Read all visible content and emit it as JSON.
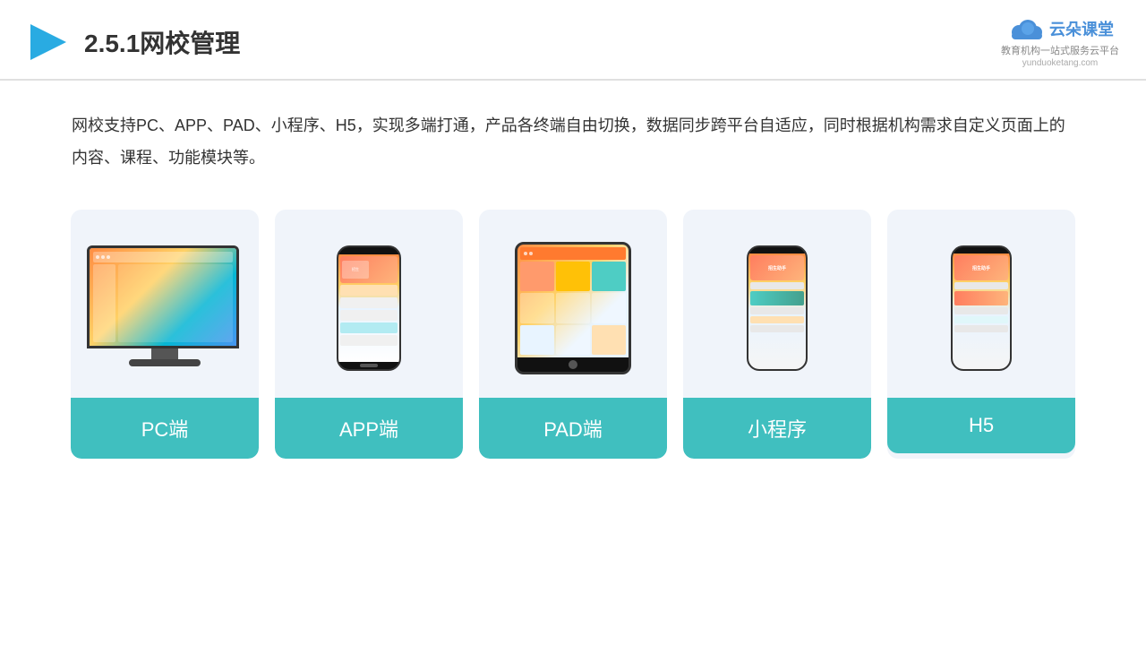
{
  "header": {
    "title_prefix": "2.5.1",
    "title_main": "网校管理",
    "logo_brand": "云朵课堂",
    "logo_tagline": "教育机构一站式服务云平台",
    "logo_domain": "yunduoketang.com"
  },
  "description": {
    "text": "网校支持PC、APP、PAD、小程序、H5，实现多端打通，产品各终端自由切换，数据同步跨平台自适应，同时根据机构需求自定义页面上的内容、课程、功能模块等。"
  },
  "cards": [
    {
      "id": "pc",
      "label": "PC端"
    },
    {
      "id": "app",
      "label": "APP端"
    },
    {
      "id": "pad",
      "label": "PAD端"
    },
    {
      "id": "miniprogram",
      "label": "小程序"
    },
    {
      "id": "h5",
      "label": "H5"
    }
  ],
  "colors": {
    "accent": "#40bfbf",
    "header_border": "#e0e0e0",
    "card_bg": "#f0f4fa",
    "title_color": "#333333",
    "text_color": "#333333"
  }
}
